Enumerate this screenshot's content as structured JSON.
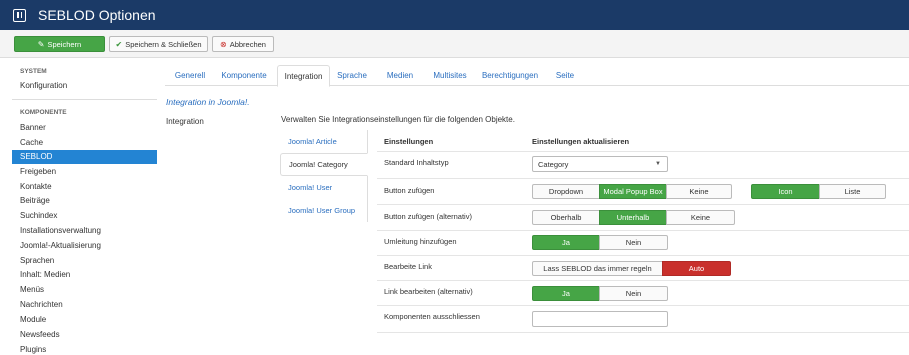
{
  "header": {
    "title": "SEBLOD Optionen",
    "icon": "options-icon"
  },
  "toolbar": {
    "save_label": "Speichern",
    "save_close_label": "Speichern & Schließen",
    "cancel_label": "Abbrechen"
  },
  "sidebar": {
    "system_heading": "SYSTEM",
    "system_items": [
      {
        "label": "Konfiguration"
      }
    ],
    "components_heading": "KOMPONENTE",
    "items": [
      {
        "label": "Banner"
      },
      {
        "label": "Cache"
      },
      {
        "label": "SEBLOD",
        "active": true
      },
      {
        "label": "Freigeben"
      },
      {
        "label": "Kontakte"
      },
      {
        "label": "Beiträge"
      },
      {
        "label": "Suchindex"
      },
      {
        "label": "Installationsverwaltung"
      },
      {
        "label": "Joomla!-Aktualisierung"
      },
      {
        "label": "Sprachen"
      },
      {
        "label": "Inhalt: Medien"
      },
      {
        "label": "Menüs"
      },
      {
        "label": "Nachrichten"
      },
      {
        "label": "Module"
      },
      {
        "label": "Newsfeeds"
      },
      {
        "label": "Plugins"
      }
    ]
  },
  "tabs": [
    {
      "label": "Generell"
    },
    {
      "label": "Komponente"
    },
    {
      "label": "Integration",
      "active": true
    },
    {
      "label": "Sprache"
    },
    {
      "label": "Medien"
    },
    {
      "label": "Multisites"
    },
    {
      "label": "Berechtigungen"
    },
    {
      "label": "Seite"
    }
  ],
  "main": {
    "intro": "Integration in Joomla!.",
    "section_label": "Integration",
    "description": "Verwalten Sie Integrationseinstellungen für die folgenden Objekte."
  },
  "subnav": [
    {
      "label": "Joomla! Article"
    },
    {
      "label": "Joomla! Category",
      "active": true
    },
    {
      "label": "Joomla! User"
    },
    {
      "label": "Joomla! User Group"
    }
  ],
  "settings": {
    "col_settings": "Einstellungen",
    "col_update": "Einstellungen aktualisieren",
    "rows": {
      "content_type": {
        "label": "Standard Inhaltstyp",
        "value": "Category"
      },
      "add_button": {
        "label": "Button zufügen",
        "options": [
          "Dropdown",
          "Modal Popup Box",
          "Keine"
        ],
        "selected": "Modal Popup Box",
        "display_options": [
          "Icon",
          "Liste"
        ],
        "display_selected": "Icon"
      },
      "add_button_alt": {
        "label": "Button zufügen (alternativ)",
        "options": [
          "Oberhalb",
          "Unterhalb",
          "Keine"
        ],
        "selected": "Unterhalb"
      },
      "redirect": {
        "label": "Umleitung hinzufügen",
        "options": [
          "Ja",
          "Nein"
        ],
        "selected": "Ja"
      },
      "edit_link": {
        "label": "Bearbeite Link",
        "options": [
          "Lass SEBLOD das immer regeln",
          "Auto"
        ],
        "selected": "Auto"
      },
      "edit_link_alt": {
        "label": "Link bearbeiten (alternativ)",
        "options": [
          "Ja",
          "Nein"
        ],
        "selected": "Ja"
      },
      "exclude_components": {
        "label": "Komponenten ausschliessen",
        "value": ""
      }
    }
  },
  "colors": {
    "header": "#1b3a67",
    "green": "#46a546",
    "red": "#c9302c",
    "active_blue": "#2384d3",
    "link": "#2a6ebf"
  }
}
